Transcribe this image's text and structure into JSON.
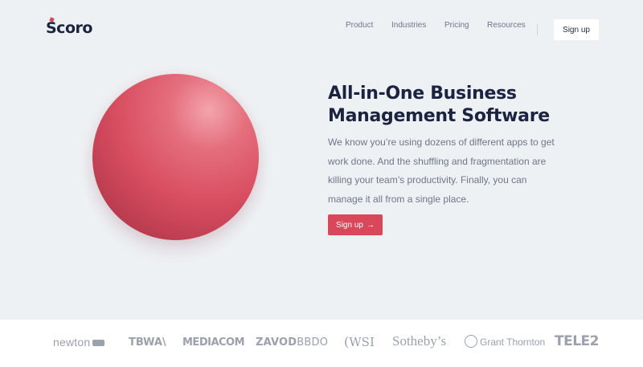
{
  "header": {
    "logo_text": "Scoro",
    "nav": [
      {
        "label": "Product"
      },
      {
        "label": "Industries"
      },
      {
        "label": "Pricing"
      },
      {
        "label": "Resources"
      }
    ],
    "signup_label": "Sign up"
  },
  "hero": {
    "title": "All-in-One Business Management Software",
    "description": "We know you’re using dozens of different apps to get work done. And the shuffling and fragmentation are killing your team’s productivity. Finally, you can manage it all from a single place.",
    "cta_label": "Sign up",
    "cta_arrow": "→",
    "accent_color": "#d8475a"
  },
  "client_logos": {
    "newton": "newton",
    "tbwa": "TBWA\\",
    "mediacom": "MEDIACOM",
    "zavod_bold": "ZAVOD",
    "zavod_light": "BBDO",
    "wsi": "WSI",
    "sothebys": "Sotheby’s",
    "grant_thornton": "Grant Thornton",
    "tele2": "TELE2"
  }
}
